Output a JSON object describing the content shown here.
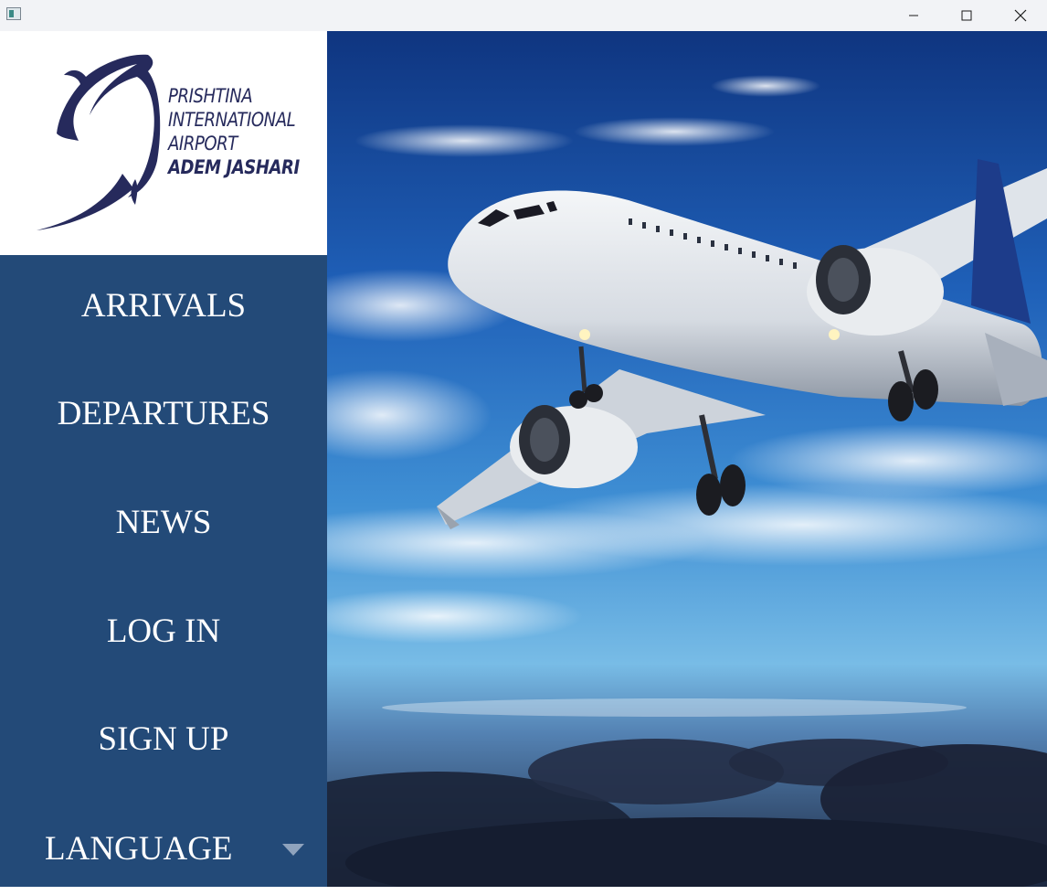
{
  "window": {
    "controls": {
      "minimize_icon": "minimize-icon",
      "maximize_icon": "maximize-icon",
      "close_icon": "close-icon"
    }
  },
  "logo": {
    "line1": "PRISHTINA",
    "line2": "INTERNATIONAL",
    "line3": "AIRPORT",
    "line4": "ADEM JASHARI"
  },
  "nav": {
    "arrivals": "ARRIVALS",
    "departures": "DEPARTURES",
    "news": "NEWS",
    "login": "LOG IN",
    "signup": "SIGN UP",
    "language": "LANGUAGE"
  },
  "colors": {
    "sidebar": "#234a78",
    "logo_navy": "#262a5c",
    "titlebar": "#f2f3f6"
  }
}
